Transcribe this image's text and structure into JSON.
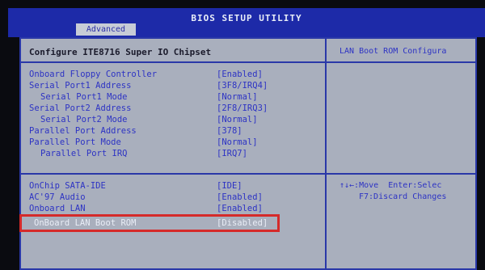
{
  "window": {
    "title": "BIOS SETUP UTILITY"
  },
  "tabs": [
    {
      "label": "Advanced"
    }
  ],
  "panel": {
    "title": "Configure ITE8716 Super IO Chipset",
    "items": [
      {
        "label": "Onboard Floppy Controller",
        "value": "[Enabled]"
      },
      {
        "label": "Serial Port1 Address",
        "value": "[3F8/IRQ4]"
      },
      {
        "label": "Serial Port1 Mode",
        "value": "[Normal]"
      },
      {
        "label": "Serial Port2 Address",
        "value": "[2F8/IRQ3]"
      },
      {
        "label": "Serial Port2 Mode",
        "value": "[Normal]"
      },
      {
        "label": "Parallel Port Address",
        "value": "[378]"
      },
      {
        "label": "Parallel Port Mode",
        "value": "[Normal]"
      },
      {
        "label": "Parallel Port IRQ",
        "value": "[IRQ7]"
      }
    ],
    "items2": [
      {
        "label": "OnChip SATA-IDE",
        "value": "[IDE]"
      },
      {
        "label": "AC'97 Audio",
        "value": "[Enabled]"
      },
      {
        "label": "Onboard LAN",
        "value": "[Enabled]"
      },
      {
        "label": "OnBoard LAN Boot ROM",
        "value": "[Disabled]"
      }
    ]
  },
  "help": {
    "title": "LAN Boot ROM Configura",
    "keys": [
      "↑↓←:Move  Enter:Selec",
      "F7:Discard Changes"
    ]
  },
  "colors": {
    "header_bg": "#1d2aa8",
    "panel_bg": "#a9afbd",
    "text": "#2d33c4",
    "selected_text": "#e9edf6",
    "highlight_box": "#d52a2a"
  }
}
